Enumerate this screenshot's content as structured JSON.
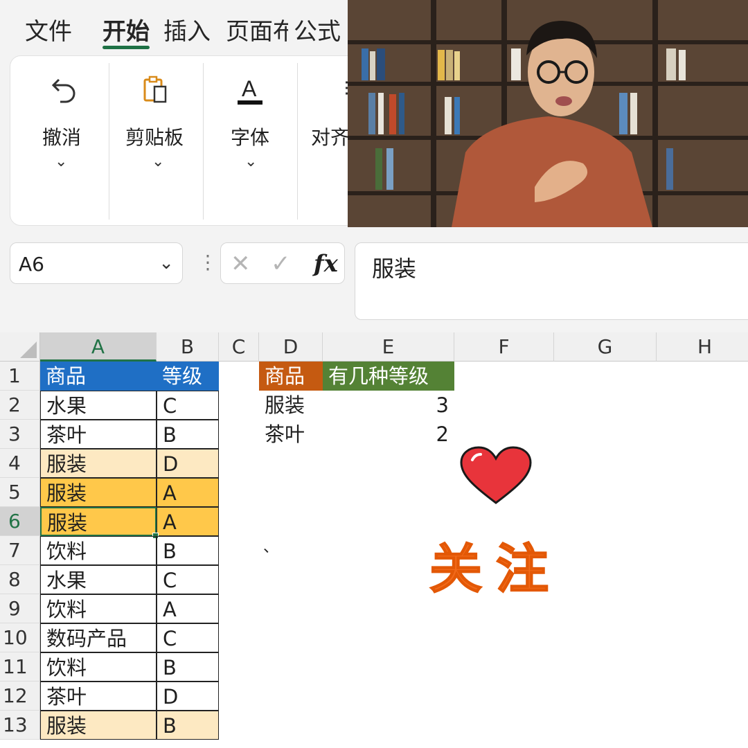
{
  "tabs": [
    "文件",
    "开始",
    "插入",
    "页面布",
    "公式"
  ],
  "active_tab": "开始",
  "ribbon": {
    "groups": [
      {
        "label": "撤消",
        "icon": "undo-icon"
      },
      {
        "label": "剪贴板",
        "icon": "clipboard-icon"
      },
      {
        "label": "字体",
        "icon": "font-color-icon"
      },
      {
        "label": "对齐",
        "icon": "align-icon"
      }
    ]
  },
  "formula_bar": {
    "name_box": "A6",
    "fx": "fx",
    "content": "服装"
  },
  "sheet": {
    "columns": [
      "A",
      "B",
      "C",
      "D",
      "E",
      "F",
      "G",
      "H"
    ],
    "selected_column": "A",
    "rows": [
      "1",
      "2",
      "3",
      "4",
      "5",
      "6",
      "7",
      "8",
      "9",
      "10",
      "11",
      "12",
      "13"
    ],
    "selected_row": "6",
    "table1": {
      "headers": [
        "商品",
        "等级"
      ],
      "rows": [
        [
          "水果",
          "C"
        ],
        [
          "茶叶",
          "B"
        ],
        [
          "服装",
          "D"
        ],
        [
          "服装",
          "A"
        ],
        [
          "服装",
          "A"
        ],
        [
          "饮料",
          "B"
        ],
        [
          "水果",
          "C"
        ],
        [
          "饮料",
          "A"
        ],
        [
          "数码产品",
          "C"
        ],
        [
          "饮料",
          "B"
        ],
        [
          "茶叶",
          "D"
        ],
        [
          "服装",
          "B"
        ]
      ]
    },
    "table2": {
      "headers": [
        "商品",
        "有几种等级"
      ],
      "rows": [
        [
          "服装",
          "3"
        ],
        [
          "茶叶",
          "2"
        ]
      ]
    },
    "stray_mark": "、"
  },
  "overlay": {
    "follow_text": "关注"
  },
  "colors": {
    "header_blue": "#1f6fc5",
    "header_orange": "#c55a11",
    "header_green": "#548235",
    "highlight_light": "#fde9c2",
    "highlight_dark": "#ffc84a",
    "excel_green": "#217346",
    "heart": "#e8343b"
  }
}
